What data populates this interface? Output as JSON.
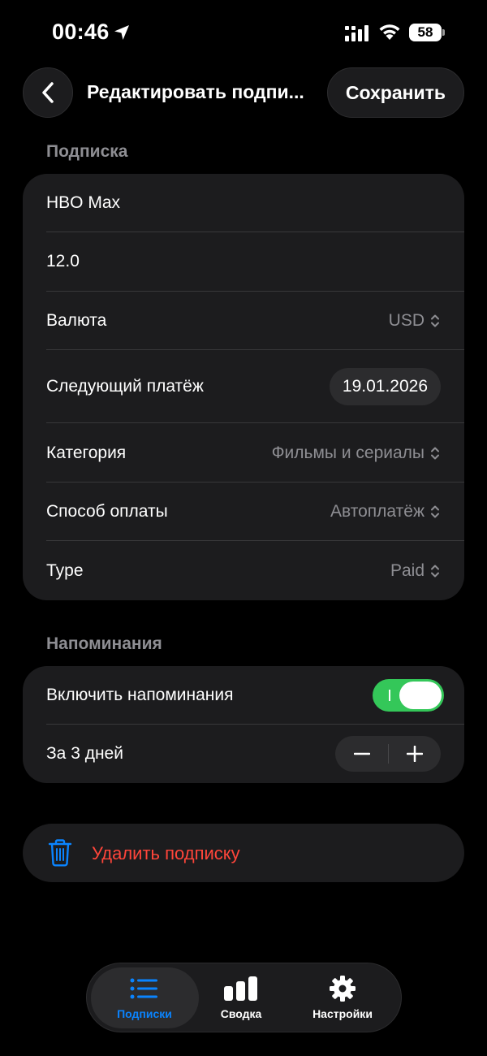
{
  "status_bar": {
    "time": "00:46",
    "battery": "58"
  },
  "nav": {
    "title": "Редактировать подпи...",
    "save_label": "Сохранить"
  },
  "subscription_section": {
    "header": "Подписка",
    "name_value": "HBO Max",
    "price_value": "12.0",
    "currency": {
      "label": "Валюта",
      "value": "USD"
    },
    "next_payment": {
      "label": "Следующий платёж",
      "value": "19.01.2026"
    },
    "category": {
      "label": "Категория",
      "value": "Фильмы и сериалы"
    },
    "payment_method": {
      "label": "Способ оплаты",
      "value": "Автоплатёж"
    },
    "type": {
      "label": "Type",
      "value": "Paid"
    }
  },
  "reminders_section": {
    "header": "Напоминания",
    "enable_label": "Включить напоминания",
    "enabled": true,
    "days_label": "За 3 дней"
  },
  "delete": {
    "label": "Удалить подписку"
  },
  "tabbar": {
    "tabs": [
      {
        "label": "Подписки",
        "icon": "list-icon",
        "active": true
      },
      {
        "label": "Сводка",
        "icon": "chart-icon",
        "active": false
      },
      {
        "label": "Настройки",
        "icon": "gear-icon",
        "active": false
      }
    ]
  },
  "colors": {
    "accent": "#0a84ff",
    "toggle_on": "#34c759",
    "destructive": "#ff453a",
    "card": "#1c1c1e"
  }
}
